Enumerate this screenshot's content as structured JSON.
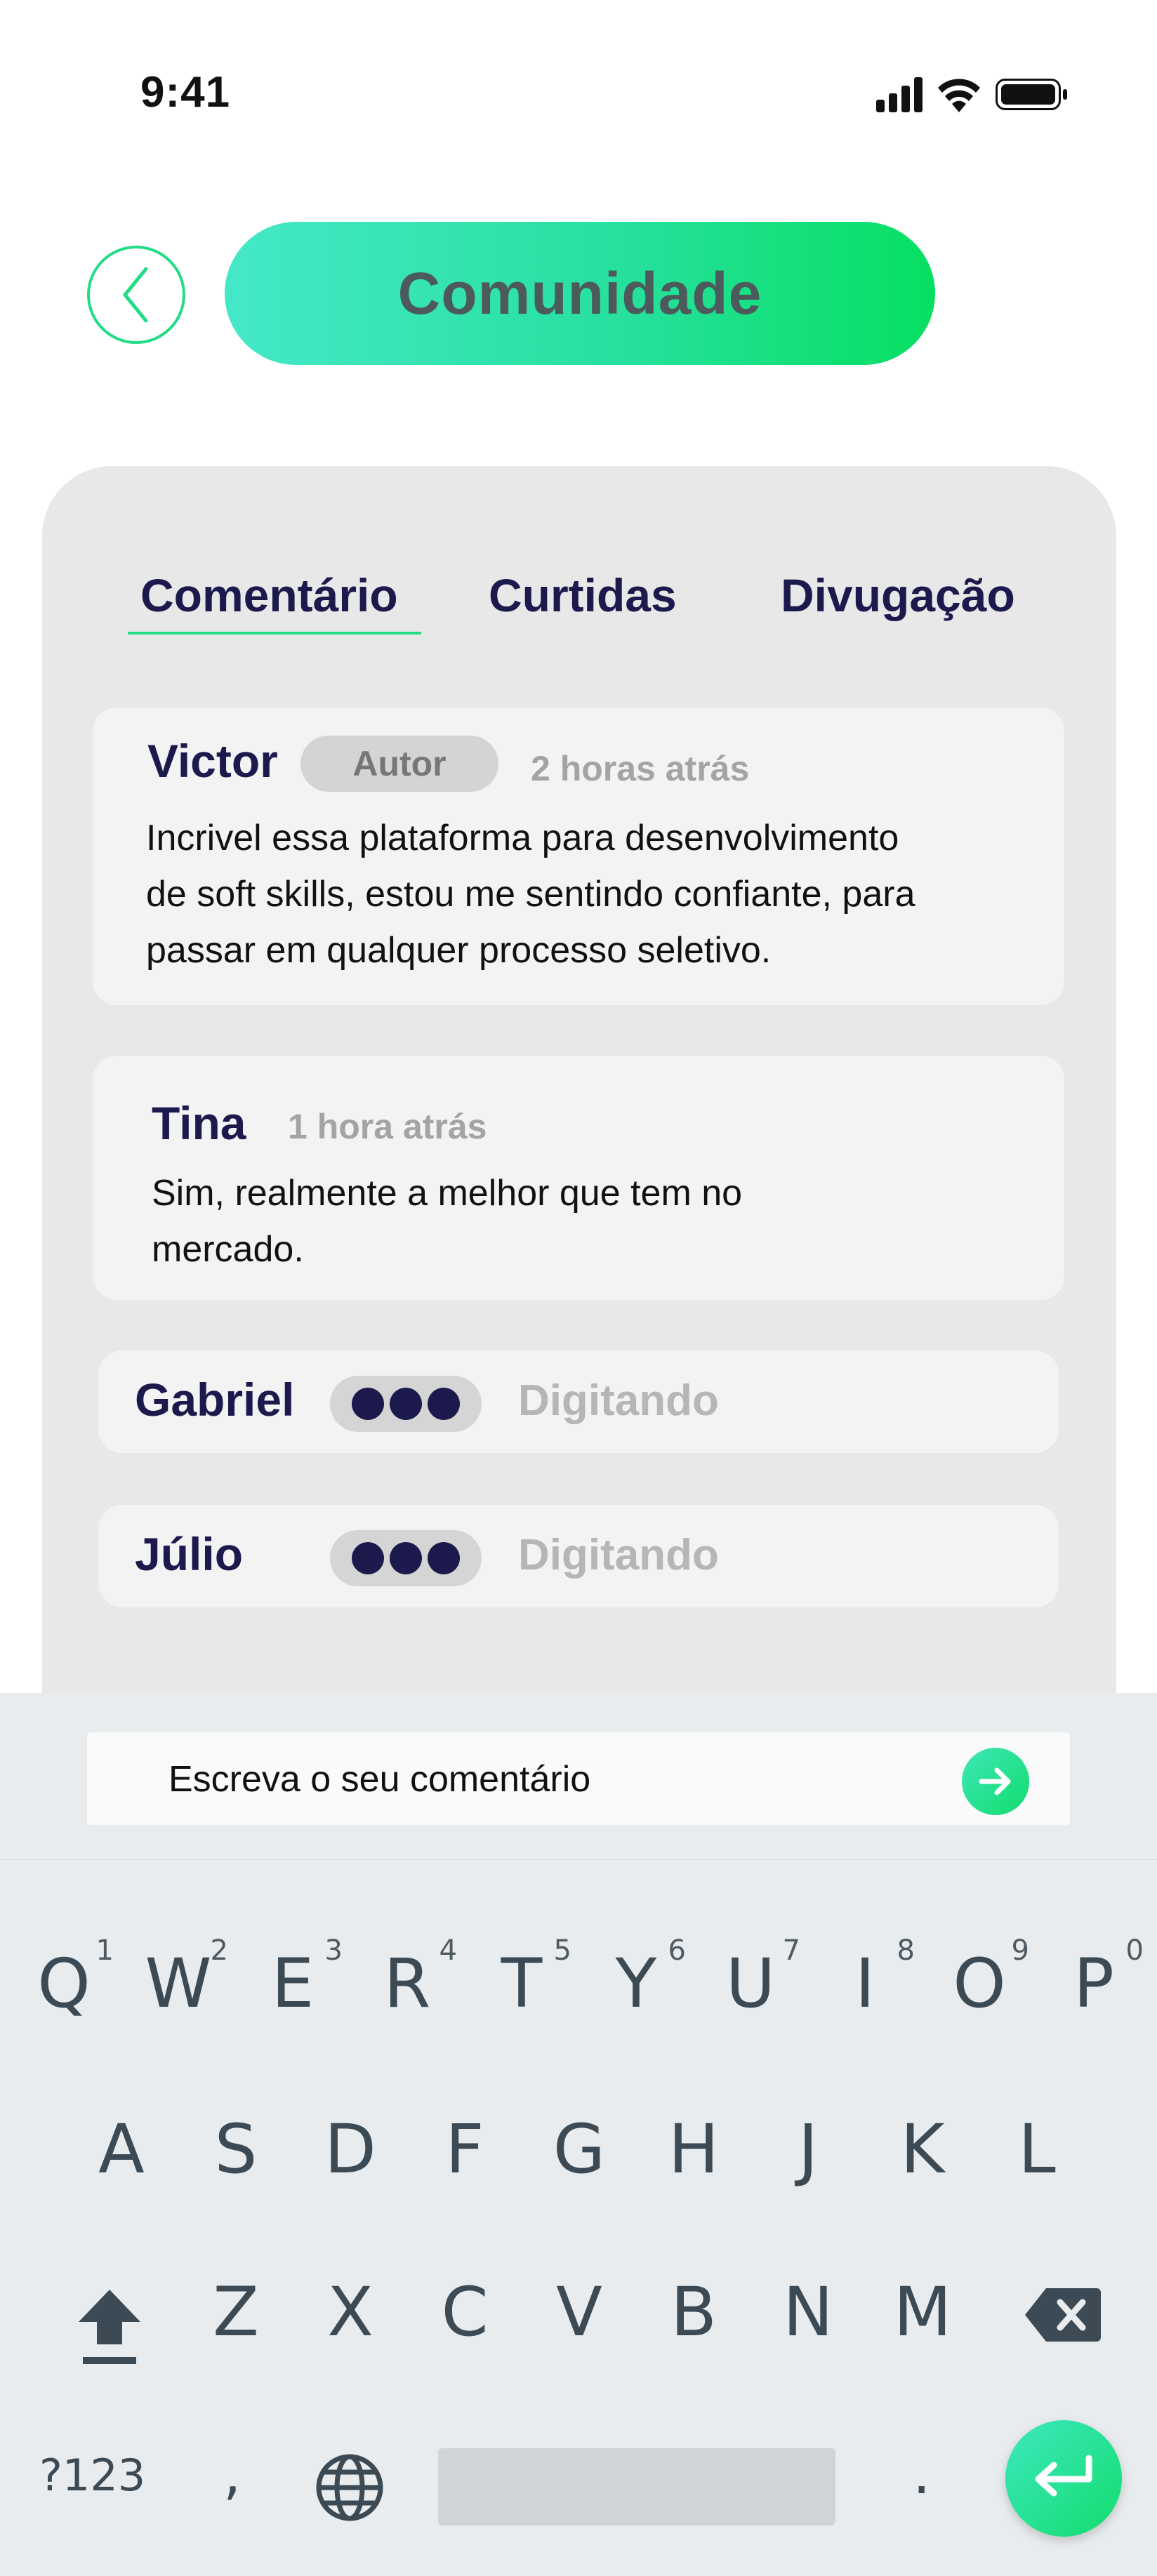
{
  "status_bar": {
    "time": "9:41"
  },
  "header": {
    "title": "Comunidade"
  },
  "tabs": [
    {
      "label": "Comentário",
      "active": true
    },
    {
      "label": "Curtidas",
      "active": false
    },
    {
      "label": "Divugação",
      "active": false
    }
  ],
  "comments": [
    {
      "name": "Victor",
      "badge": "Autor",
      "time": "2 horas atrás",
      "lines": [
        "Incrivel essa plataforma para desenvolvimento",
        "de soft skills, estou me sentindo confiante, para",
        "passar em qualquer processo seletivo."
      ]
    },
    {
      "name": "Tina",
      "time": "1 hora atrás",
      "lines": [
        "Sim, realmente a melhor que tem no",
        "mercado."
      ]
    }
  ],
  "typing": [
    {
      "name": "Gabriel",
      "status": "Digitando"
    },
    {
      "name": "Júlio",
      "status": "Digitando"
    }
  ],
  "comment_box": {
    "placeholder": "Escreva o seu comentário"
  },
  "keyboard": {
    "row1": [
      "Q",
      "W",
      "E",
      "R",
      "T",
      "Y",
      "U",
      "I",
      "O",
      "P"
    ],
    "row1_hints": [
      "1",
      "2",
      "3",
      "4",
      "5",
      "6",
      "7",
      "8",
      "9",
      "0"
    ],
    "row2": [
      "A",
      "S",
      "D",
      "F",
      "G",
      "H",
      "J",
      "K",
      "L"
    ],
    "row3": [
      "Z",
      "X",
      "C",
      "V",
      "B",
      "N",
      "M"
    ],
    "symbols_label": "?123",
    "comma": ",",
    "period": "."
  },
  "colors": {
    "accent_green": "#22dc86",
    "navy_text": "#1c1a4d",
    "panel_gray": "#e8e8e8"
  },
  "icons": [
    "chevron-left-icon",
    "signal-icon",
    "wifi-icon",
    "battery-icon",
    "arrow-right-icon",
    "shift-icon",
    "backspace-icon",
    "globe-icon",
    "enter-icon"
  ]
}
